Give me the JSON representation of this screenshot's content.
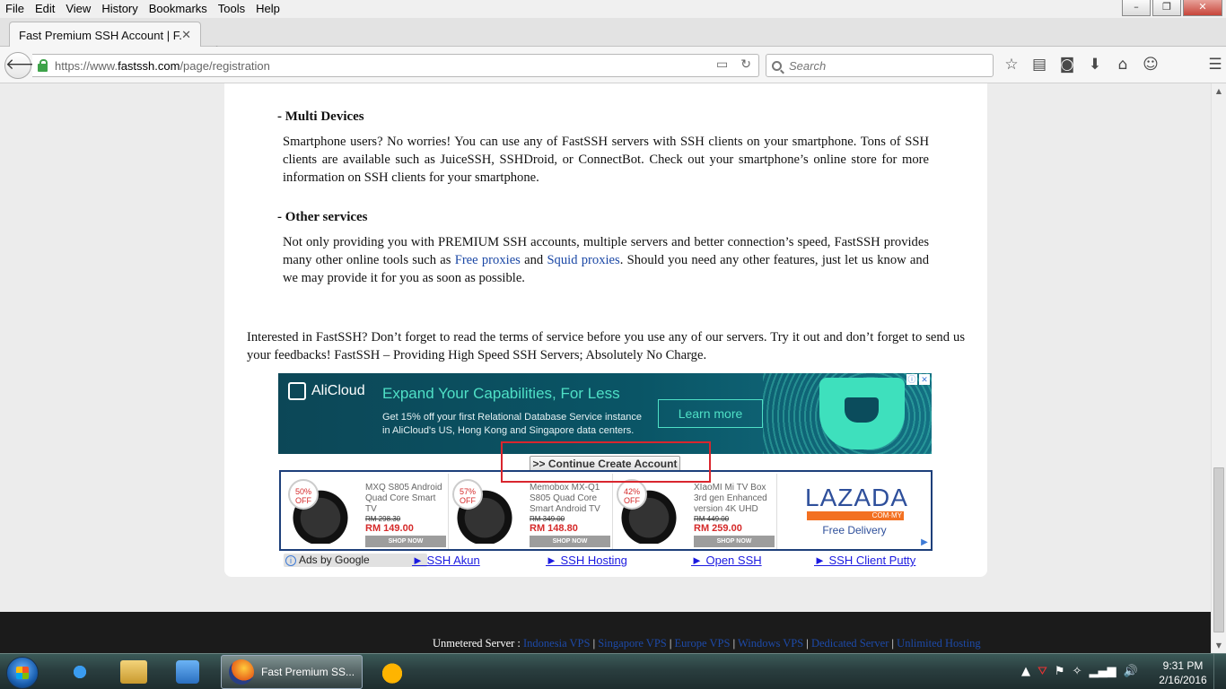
{
  "menu": [
    "File",
    "Edit",
    "View",
    "History",
    "Bookmarks",
    "Tools",
    "Help"
  ],
  "window_controls": {
    "minimize": "–",
    "restore": "❐",
    "close": "✕"
  },
  "tab": {
    "title": "Fast Premium SSH Account | F...",
    "close": "✕",
    "new_tab": "+"
  },
  "nav": {
    "url_prefix": "https://www.",
    "url_domain": "fastssh.com",
    "url_path": "/page/registration",
    "search_placeholder": "Search"
  },
  "content": {
    "sec1_title": "- Multi Devices",
    "sec1_body": "Smartphone users? No worries! You can use any of FastSSH servers with SSH clients on your smartphone. Tons of SSH clients are available such as JuiceSSH, SSHDroid, or ConnectBot. Check out your smartphone’s online store for more information on SSH clients for your smartphone.",
    "sec2_title": "- Other services",
    "sec2_body_a": "Not only providing you with PREMIUM SSH accounts, multiple servers and better connection’s speed, FastSSH provides many other online tools such as ",
    "sec2_link1": "Free proxies",
    "sec2_body_b": " and ",
    "sec2_link2": "Squid proxies",
    "sec2_body_c": ". Should you need any other features, just let us know and we may provide it for you as soon as possible.",
    "outro": "Interested in FastSSH? Don’t forget to read the terms of service before you use any of our servers. Try it out and don’t forget to send us your feedbacks! FastSSH – Providing High Speed SSH Servers; Absolutely No Charge."
  },
  "ad_alicloud": {
    "brand": "AliCloud",
    "headline": "Expand Your Capabilities, For Less",
    "sub": "Get 15% off your first Relational Database Service instance in AliCloud's US, Hong Kong and Singapore data centers.",
    "cta": "Learn more"
  },
  "continue_button": ">> Continue Create Account",
  "ad_lazada": {
    "products": [
      {
        "discount": "50%",
        "off": "OFF",
        "name": "MXQ S805 Android Quad Core Smart TV",
        "old_price": "RM 298.30",
        "price": "RM 149.00",
        "shop": "SHOP NOW"
      },
      {
        "discount": "57%",
        "off": "OFF",
        "name": "Memobox MX-Q1 S805 Quad Core Smart Android TV",
        "old_price": "RM 349.00",
        "price": "RM 148.80",
        "shop": "SHOP NOW"
      },
      {
        "discount": "42%",
        "off": "OFF",
        "name": "XIaoMI Mi TV Box 3rd gen Enhanced version 4K UHD",
        "old_price": "RM 449.00",
        "price": "RM 259.00",
        "shop": "SHOP NOW"
      }
    ],
    "brand": "LAZADA",
    "brand_sub": "COM·MY",
    "free_delivery": "Free Delivery"
  },
  "ads_by_google": "Ads by Google",
  "ad_links": [
    "► SSH Akun",
    "► SSH Hosting",
    "► Open SSH",
    "► SSH Client Putty"
  ],
  "footer": {
    "label": "Unmetered Server : ",
    "links": [
      "Indonesia VPS",
      "Singapore VPS",
      "Europe VPS",
      "Windows VPS",
      "Dedicated Server",
      "Unlimited Hosting"
    ],
    "sep": " | "
  },
  "taskbar": {
    "task_label": "Fast Premium SS...",
    "time": "9:31 PM",
    "date": "2/16/2016"
  }
}
